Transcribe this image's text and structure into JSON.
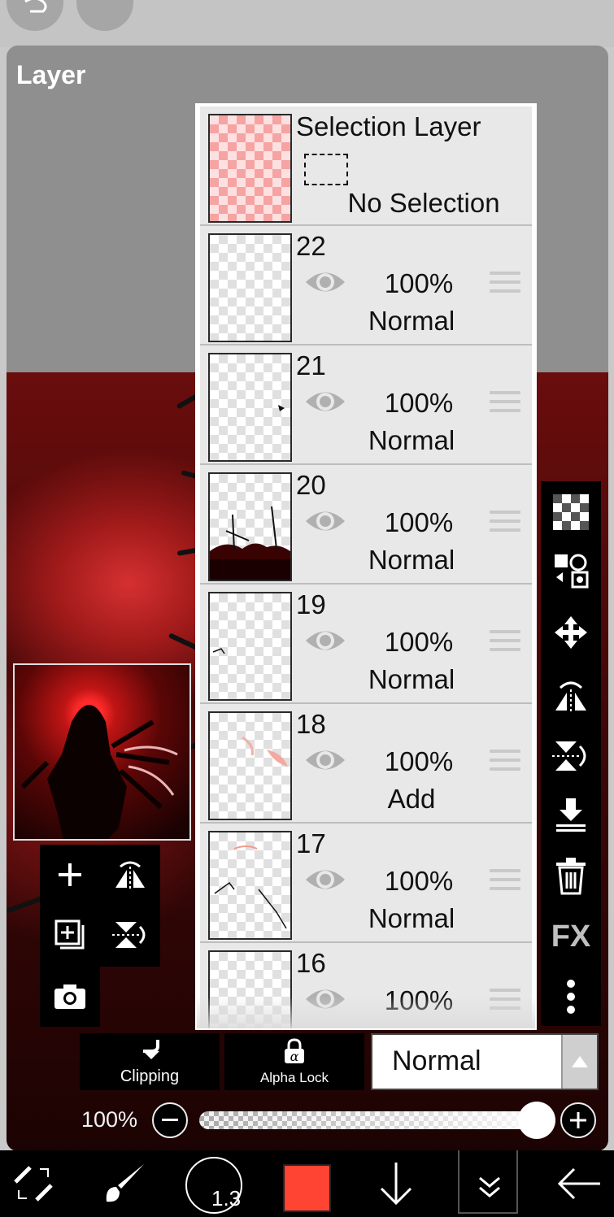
{
  "panel": {
    "title": "Layer"
  },
  "layers": [
    {
      "name": "Selection Layer",
      "status": "No Selection",
      "type": "selection"
    },
    {
      "name": "22",
      "opacity": "100%",
      "blend": "Normal"
    },
    {
      "name": "21",
      "opacity": "100%",
      "blend": "Normal"
    },
    {
      "name": "20",
      "opacity": "100%",
      "blend": "Normal"
    },
    {
      "name": "19",
      "opacity": "100%",
      "blend": "Normal"
    },
    {
      "name": "18",
      "opacity": "100%",
      "blend": "Add"
    },
    {
      "name": "17",
      "opacity": "100%",
      "blend": "Normal"
    },
    {
      "name": "16",
      "opacity": "100%",
      "blend": ""
    }
  ],
  "options": {
    "clipping_label": "Clipping",
    "alpha_lock_label": "Alpha Lock",
    "blend_mode": "Normal"
  },
  "opacity": {
    "label": "100%",
    "value": 1.0
  },
  "right_toolbar": {
    "fx_label": "FX"
  },
  "bottom_toolbar": {
    "brush_size": "1.3",
    "color": "#ff4433"
  },
  "icons": [
    "undo-icon",
    "eye-icon",
    "drag-handle-icon",
    "checkerboard-icon",
    "swap-layer-icon",
    "move-icon",
    "flip-horizontal-icon",
    "flip-vertical-icon",
    "merge-down-icon",
    "trash-icon",
    "more-icon",
    "add-layer-icon",
    "duplicate-layer-icon",
    "camera-icon",
    "clipping-icon",
    "alpha-lock-icon",
    "minus-icon",
    "plus-icon",
    "transform-icon",
    "brush-icon",
    "arrow-down-icon",
    "double-chevron-icon",
    "back-arrow-icon"
  ]
}
